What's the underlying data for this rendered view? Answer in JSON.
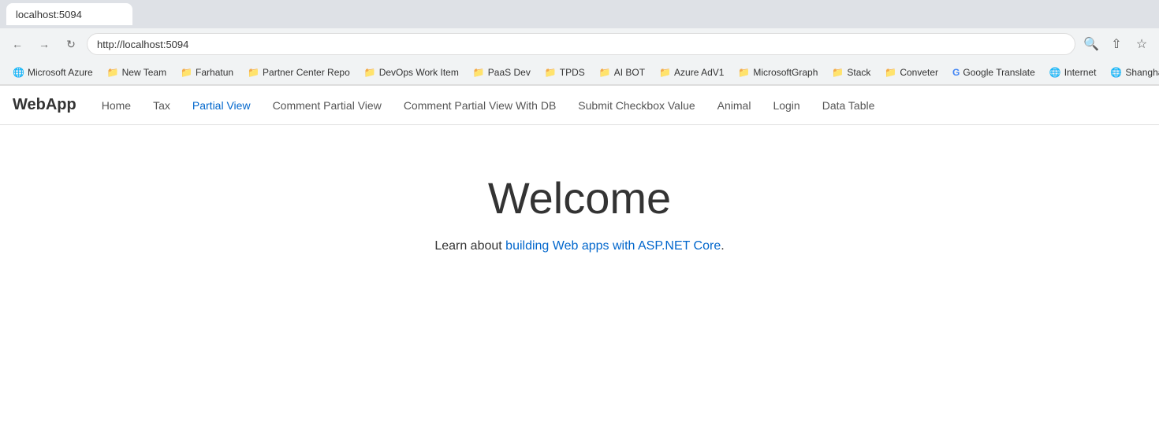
{
  "browser": {
    "url": "http://localhost:5094",
    "tab_title": "localhost:5094"
  },
  "bookmarks": [
    {
      "label": "Microsoft Azure",
      "type": "globe",
      "icon": "🌐"
    },
    {
      "label": "New Team",
      "type": "folder",
      "icon": "📁"
    },
    {
      "label": "Farhatun",
      "type": "folder",
      "icon": "📁"
    },
    {
      "label": "Partner Center Repo",
      "type": "folder",
      "icon": "📁"
    },
    {
      "label": "DevOps Work Item",
      "type": "folder",
      "icon": "📁"
    },
    {
      "label": "PaaS Dev",
      "type": "folder",
      "icon": "📁"
    },
    {
      "label": "TPDS",
      "type": "folder",
      "icon": "📁"
    },
    {
      "label": "AI BOT",
      "type": "folder",
      "icon": "📁"
    },
    {
      "label": "Azure AdV1",
      "type": "folder",
      "icon": "📁"
    },
    {
      "label": "MicrosoftGraph",
      "type": "folder",
      "icon": "📁"
    },
    {
      "label": "Stack",
      "type": "folder",
      "icon": "📁"
    },
    {
      "label": "Conveter",
      "type": "folder",
      "icon": "📁"
    },
    {
      "label": "Google Translate",
      "type": "special",
      "icon": "🔵"
    },
    {
      "label": "Internet",
      "type": "globe",
      "icon": "🌐"
    },
    {
      "label": "Shanghai",
      "type": "globe",
      "icon": "🌐"
    }
  ],
  "navbar": {
    "brand": "WebApp",
    "links": [
      {
        "label": "Home",
        "active": false
      },
      {
        "label": "Tax",
        "active": false
      },
      {
        "label": "Partial View",
        "active": true
      },
      {
        "label": "Comment Partial View",
        "active": false
      },
      {
        "label": "Comment Partial View With DB",
        "active": false
      },
      {
        "label": "Submit Checkbox Value",
        "active": false
      },
      {
        "label": "Animal",
        "active": false
      },
      {
        "label": "Login",
        "active": false
      },
      {
        "label": "Data Table",
        "active": false
      }
    ]
  },
  "content": {
    "welcome_title": "Welcome",
    "subtitle_text": "Learn about ",
    "link_text": "building Web apps with ASP.NET Core",
    "suffix_text": "."
  }
}
